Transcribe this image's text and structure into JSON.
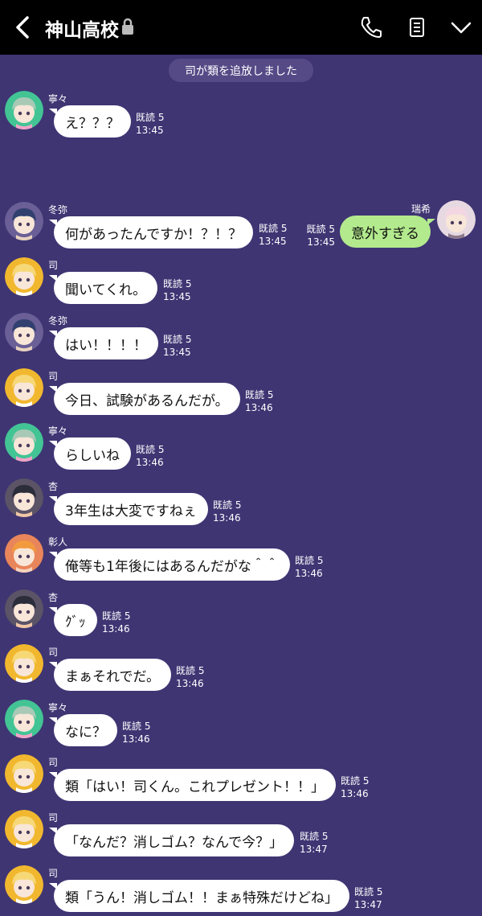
{
  "header": {
    "title": "神山高校",
    "icons": [
      "back-icon",
      "lock-icon",
      "phone-icon",
      "notes-icon",
      "chevron-down-icon"
    ]
  },
  "system_message": "司が類を追放しました",
  "colors": {
    "header_bg": "#000000",
    "chat_bg": "#3f3573",
    "bubble_incoming": "#ffffff",
    "bubble_outgoing": "#b3ea8d"
  },
  "messages": [
    {
      "sender": "寧々",
      "text": "え？？？",
      "read": "既読 5",
      "time": "13:45"
    },
    {
      "sender": "瑞希",
      "text": "意外すぎる",
      "read": "既読 5",
      "time": "13:45",
      "outgoing": true
    },
    {
      "sender": "冬弥",
      "text": "何があったんですか！？！？",
      "read": "既読 5",
      "time": "13:45"
    },
    {
      "sender": "司",
      "text": "聞いてくれ。",
      "read": "既読 5",
      "time": "13:45"
    },
    {
      "sender": "冬弥",
      "text": "はい！！！！",
      "read": "既読 5",
      "time": "13:45"
    },
    {
      "sender": "司",
      "text": "今日、試験があるんだが。",
      "read": "既読 5",
      "time": "13:46"
    },
    {
      "sender": "寧々",
      "text": "らしいね",
      "read": "既読 5",
      "time": "13:46"
    },
    {
      "sender": "杏",
      "text": "3年生は大変ですねぇ",
      "read": "既読 5",
      "time": "13:46"
    },
    {
      "sender": "彰人",
      "text": "俺等も1年後にはあるんだがな＾＾",
      "read": "既読 5",
      "time": "13:46"
    },
    {
      "sender": "杏",
      "text": "ｸﾞｯ",
      "read": "既読 5",
      "time": "13:46"
    },
    {
      "sender": "司",
      "text": "まぁそれでだ。",
      "read": "既読 5",
      "time": "13:46"
    },
    {
      "sender": "寧々",
      "text": "なに？",
      "read": "既読 5",
      "time": "13:46"
    },
    {
      "sender": "司",
      "text": "類「はい！司くん。これプレゼント！！」",
      "read": "既読 5",
      "time": "13:46"
    },
    {
      "sender": "司",
      "text": "「なんだ？消しゴム？なんで今？」",
      "read": "既読 5",
      "time": "13:47"
    },
    {
      "sender": "司",
      "text": "類「うん！消しゴム！！まぁ特殊だけどね」",
      "read": "既読 5",
      "time": "13:47"
    }
  ]
}
